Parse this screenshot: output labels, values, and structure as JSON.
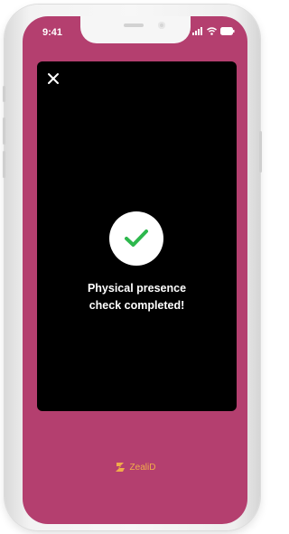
{
  "status_bar": {
    "time": "9:41",
    "icons": [
      "signal-icon",
      "wifi-icon",
      "battery-icon"
    ]
  },
  "verification": {
    "close_icon": "close-icon",
    "status_icon": "checkmark-icon",
    "line1": "Physical presence",
    "line2": "check completed!"
  },
  "brand": {
    "logo_icon": "zealid-logo-icon",
    "name": "ZealiD"
  },
  "colors": {
    "screen_background": "#b43f6f",
    "panel_background": "#000000",
    "check_color": "#2db84d",
    "brand_color": "#f0ad4a"
  }
}
